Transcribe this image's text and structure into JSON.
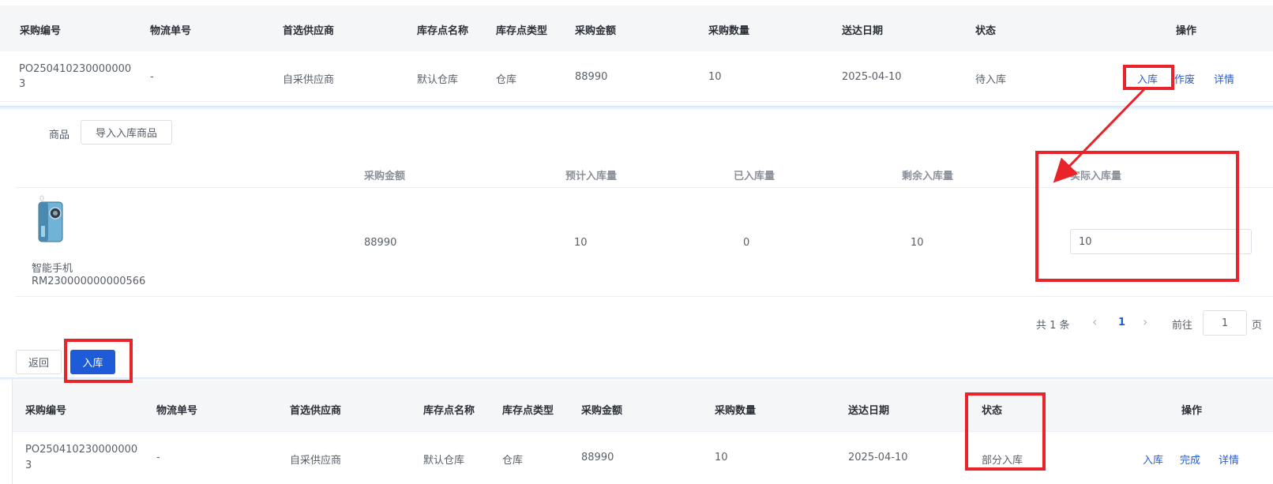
{
  "top_table": {
    "headers": [
      "采购编号",
      "物流单号",
      "首选供应商",
      "库存点名称",
      "库存点类型",
      "采购金额",
      "采购数量",
      "送达日期",
      "状态",
      "操作"
    ],
    "row": {
      "po_line1": "PO250410230000000",
      "po_line2": "3",
      "logistics": "-",
      "supplier": "自采供应商",
      "store_name": "默认仓库",
      "store_type": "仓库",
      "amount": "88990",
      "quantity": "10",
      "date": "2025-04-10",
      "status": "待入库",
      "actions": [
        "入库",
        "作废",
        "详情"
      ]
    }
  },
  "stock_in_panel": {
    "goods_label": "商品",
    "import_button": "导入入库商品",
    "columns": [
      "采购金额",
      "预计入库量",
      "已入库量",
      "剩余入库量",
      "实际入库量"
    ],
    "item": {
      "image_icon": "phone-product-image",
      "name": "智能手机",
      "sku": "RM230000000000566",
      "amount": "88990",
      "expected": "10",
      "received": "0",
      "remaining": "10",
      "actual": "10"
    },
    "pagination": {
      "total": "共 1 条",
      "prev_icon": "chevron-left-icon",
      "current": "1",
      "next_icon": "chevron-right-icon",
      "goto_label": "前往",
      "goto_value": "1",
      "page_suffix": "页"
    },
    "back_button": "返回",
    "submit_button": "入库"
  },
  "bottom_table": {
    "headers": [
      "采购编号",
      "物流单号",
      "首选供应商",
      "库存点名称",
      "库存点类型",
      "采购金额",
      "采购数量",
      "送达日期",
      "状态",
      "操作"
    ],
    "row": {
      "po_line1": "PO250410230000000",
      "po_line2": "3",
      "logistics": "-",
      "supplier": "自采供应商",
      "store_name": "默认仓库",
      "store_type": "仓库",
      "amount": "88990",
      "quantity": "10",
      "date": "2025-04-10",
      "status": "部分入库",
      "actions": [
        "入库",
        "完成",
        "详情"
      ]
    }
  },
  "colors": {
    "primary": "#1e5bd8",
    "link": "#2b5ccc",
    "annotation_red": "#e8232a",
    "header_bg": "#f5f6f8"
  }
}
